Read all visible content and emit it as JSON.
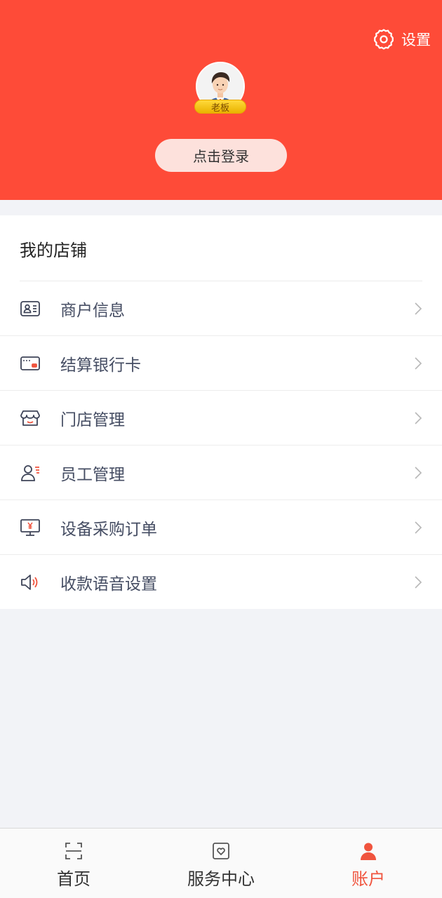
{
  "header": {
    "settings_label": "设置",
    "avatar_badge": "老板",
    "login_label": "点击登录"
  },
  "shop": {
    "title": "我的店铺",
    "items": [
      {
        "label": "商户信息",
        "icon": "id-card-icon"
      },
      {
        "label": "结算银行卡",
        "icon": "bank-card-icon"
      },
      {
        "label": "门店管理",
        "icon": "store-icon"
      },
      {
        "label": "员工管理",
        "icon": "staff-icon"
      },
      {
        "label": "设备采购订单",
        "icon": "monitor-yen-icon"
      },
      {
        "label": "收款语音设置",
        "icon": "speaker-icon"
      }
    ]
  },
  "tabbar": {
    "tabs": [
      {
        "label": "首页",
        "icon": "scan-icon",
        "active": false
      },
      {
        "label": "服务中心",
        "icon": "service-heart-icon",
        "active": false
      },
      {
        "label": "账户",
        "icon": "user-icon",
        "active": true
      }
    ]
  },
  "colors": {
    "brand": "#fe4b38",
    "accent_icon": "#f0543e",
    "menu_text": "#454d63"
  }
}
